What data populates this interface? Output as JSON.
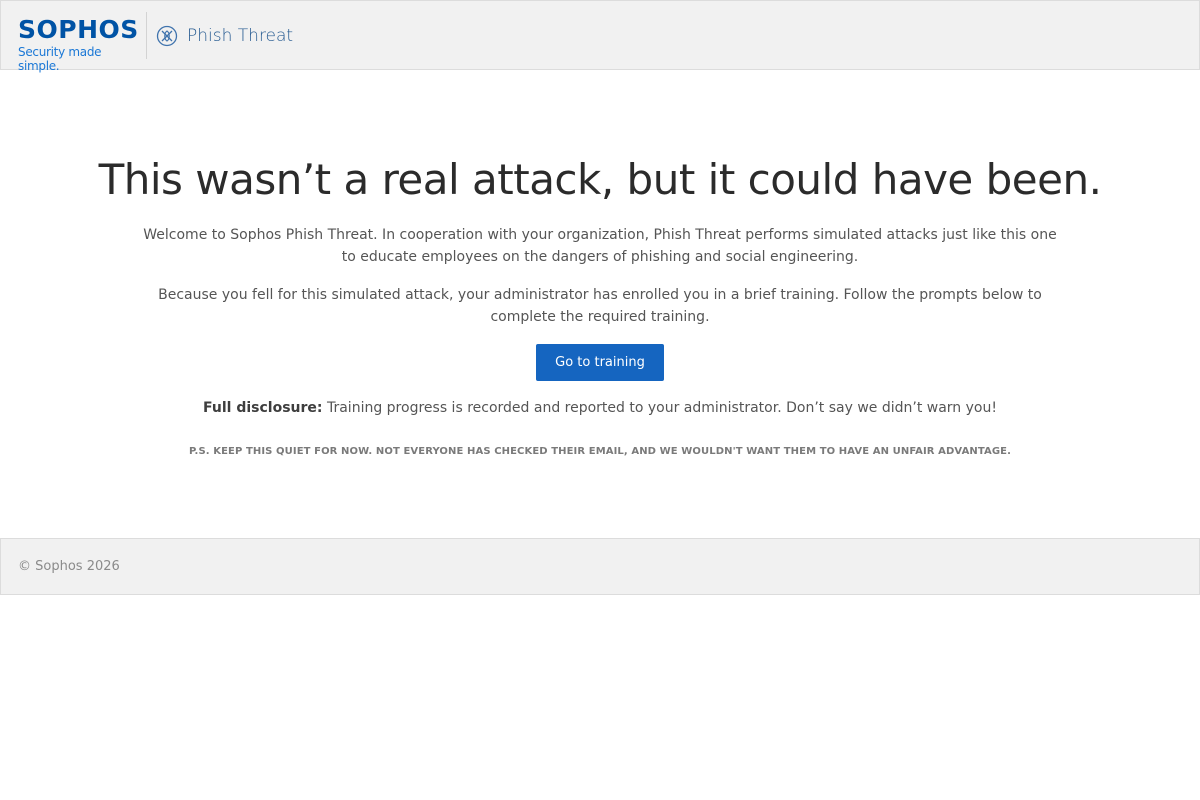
{
  "header": {
    "logo_word": "SOPHOS",
    "logo_tagline": "Security made simple.",
    "product_icon": "phish-threat-icon",
    "product_name": "Phish Threat"
  },
  "main": {
    "headline": "This wasn’t a real attack, but it could have been.",
    "paragraph1": "Welcome to Sophos Phish Threat. In cooperation with your organization, Phish Threat performs simulated attacks just like this one to educate employees on the dangers of phishing and social engineering.",
    "paragraph2": "Because you fell for this simulated attack, your administrator has enrolled you in a brief training. Follow the prompts below to complete the required training.",
    "training_button": "Go to training",
    "disclosure_label": "Full disclosure:",
    "disclosure_text": " Training progress is recorded and reported to your administrator. Don’t say we didn’t warn you!",
    "ps_note": "P.S. KEEP THIS QUIET FOR NOW. NOT EVERYONE HAS CHECKED THEIR EMAIL, AND WE WOULDN'T WANT THEM TO HAVE AN UNFAIR ADVANTAGE."
  },
  "footer": {
    "copyright": "© Sophos 2026"
  },
  "colors": {
    "brand_blue": "#0053a5",
    "button_blue": "#1565c0",
    "header_bg": "#f1f1f1"
  }
}
